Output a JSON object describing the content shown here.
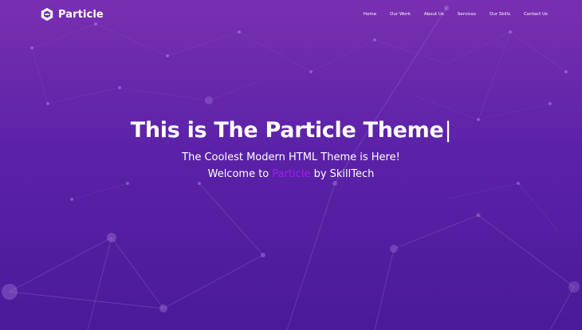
{
  "brand": {
    "name": "Particle",
    "icon": "particle-logo-icon"
  },
  "nav": {
    "items": [
      {
        "label": "Home"
      },
      {
        "label": "Our Work"
      },
      {
        "label": "About Us"
      },
      {
        "label": "Services"
      },
      {
        "label": "Our Skills"
      },
      {
        "label": "Contact Us"
      }
    ]
  },
  "hero": {
    "title": "This is The Particle Theme",
    "cursor": "|",
    "line1": "The Coolest Modern HTML Theme is Here!",
    "line2_prefix": "Welcome to ",
    "line2_highlight": "Particle",
    "line2_suffix": " by SkillTech"
  },
  "colors": {
    "background_top": "#7a2fb0",
    "background_bottom": "#4a1a9a",
    "highlight": "#a21bf5",
    "text": "#ffffff"
  }
}
